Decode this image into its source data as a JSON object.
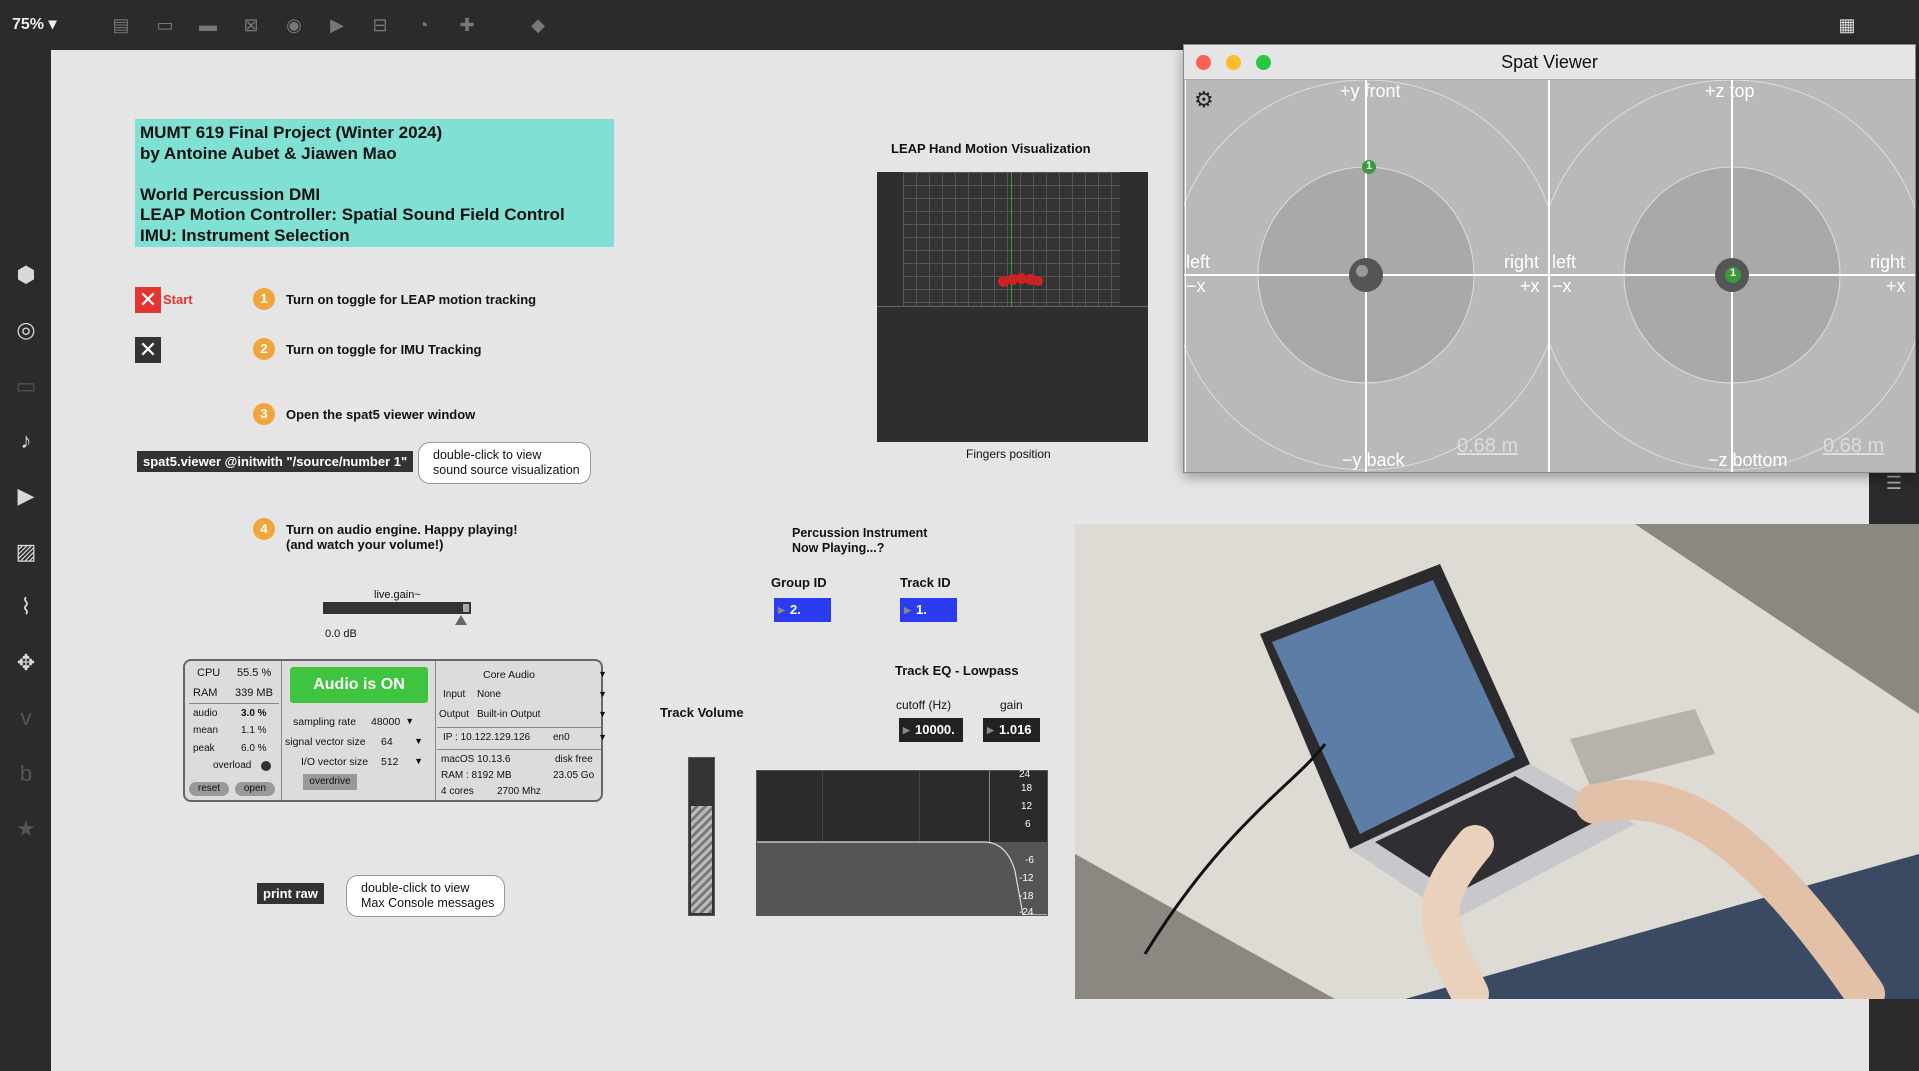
{
  "toolbar": {
    "zoom": "75%"
  },
  "title_box": {
    "line1": "MUMT 619 Final Project (Winter 2024)",
    "line2": "by Antoine Aubet & Jiawen Mao",
    "line3": "World Percussion DMI",
    "line4": "LEAP Motion Controller: Spatial Sound Field Control",
    "line5": "IMU: Instrument Selection"
  },
  "start_label": "Start",
  "steps": [
    {
      "num": "1",
      "text": "Turn on toggle for LEAP motion tracking"
    },
    {
      "num": "2",
      "text": "Turn on toggle for IMU Tracking"
    },
    {
      "num": "3",
      "text": "Open the spat5 viewer window"
    },
    {
      "num": "4",
      "text_line1": "Turn on audio engine. Happy playing!",
      "text_line2": "(and watch your volume!)"
    }
  ],
  "spat_message": "spat5.viewer @initwith \"/source/number 1\"",
  "spat_comment": {
    "line1": "double-click to view",
    "line2": "sound source visualization"
  },
  "live_gain": {
    "label": "live.gain~",
    "value": "0.0 dB"
  },
  "audio_panel": {
    "cpu_label": "CPU",
    "cpu_value": "55.5 %",
    "ram_label": "RAM",
    "ram_value": "339 MB",
    "audio_label": "audio",
    "audio_value": "3.0 %",
    "mean_label": "mean",
    "mean_value": "1.1 %",
    "peak_label": "peak",
    "peak_value": "6.0 %",
    "overload_label": "overload",
    "reset": "reset",
    "open": "open",
    "audio_on": "Audio is ON",
    "sampling_rate_label": "sampling rate",
    "sampling_rate": "48000",
    "signal_vector_label": "signal vector size",
    "signal_vector": "64",
    "io_vector_label": "I/O vector size",
    "io_vector": "512",
    "overdrive": "overdrive",
    "driver": "Core Audio",
    "input_label": "Input",
    "input_value": "None",
    "output_label": "Output",
    "output_value": "Built-in Output",
    "ip": "IP : 10.122.129.126",
    "iface": "en0",
    "os": "macOS 10.13.6",
    "disk_label": "disk free",
    "ram_total": "RAM : 8192 MB",
    "disk_value": "23.05 Go",
    "cores": "4 cores",
    "mhz": "2700 Mhz"
  },
  "print_raw": "print raw",
  "print_comment": {
    "line1": "double-click to view",
    "line2": "Max Console messages"
  },
  "leap": {
    "title": "LEAP Hand Motion Visualization",
    "caption": "Fingers position"
  },
  "percussion": {
    "line1": "Percussion Instrument",
    "line2": "Now Playing...?"
  },
  "group_id": {
    "label": "Group ID",
    "value": "2."
  },
  "track_id": {
    "label": "Track ID",
    "value": "1."
  },
  "track_eq": {
    "title": "Track EQ - Lowpass",
    "cutoff_label": "cutoff (Hz)",
    "cutoff_value": "10000.",
    "gain_label": "gain",
    "gain_value": "1.016"
  },
  "track_volume": "Track Volume",
  "eq_scale": [
    "24",
    "18",
    "12",
    "6",
    "-6",
    "-12",
    "-18",
    "-24"
  ],
  "spat_viewer": {
    "title": "Spat Viewer",
    "left_top": "+y front",
    "left_bottom": "−y back",
    "right_top": "+z top",
    "right_bottom": "−z bottom",
    "left": "left",
    "right": "right",
    "neg_x": "−x",
    "pos_x": "+x",
    "distance": "0.68 m",
    "source_num": "1"
  }
}
